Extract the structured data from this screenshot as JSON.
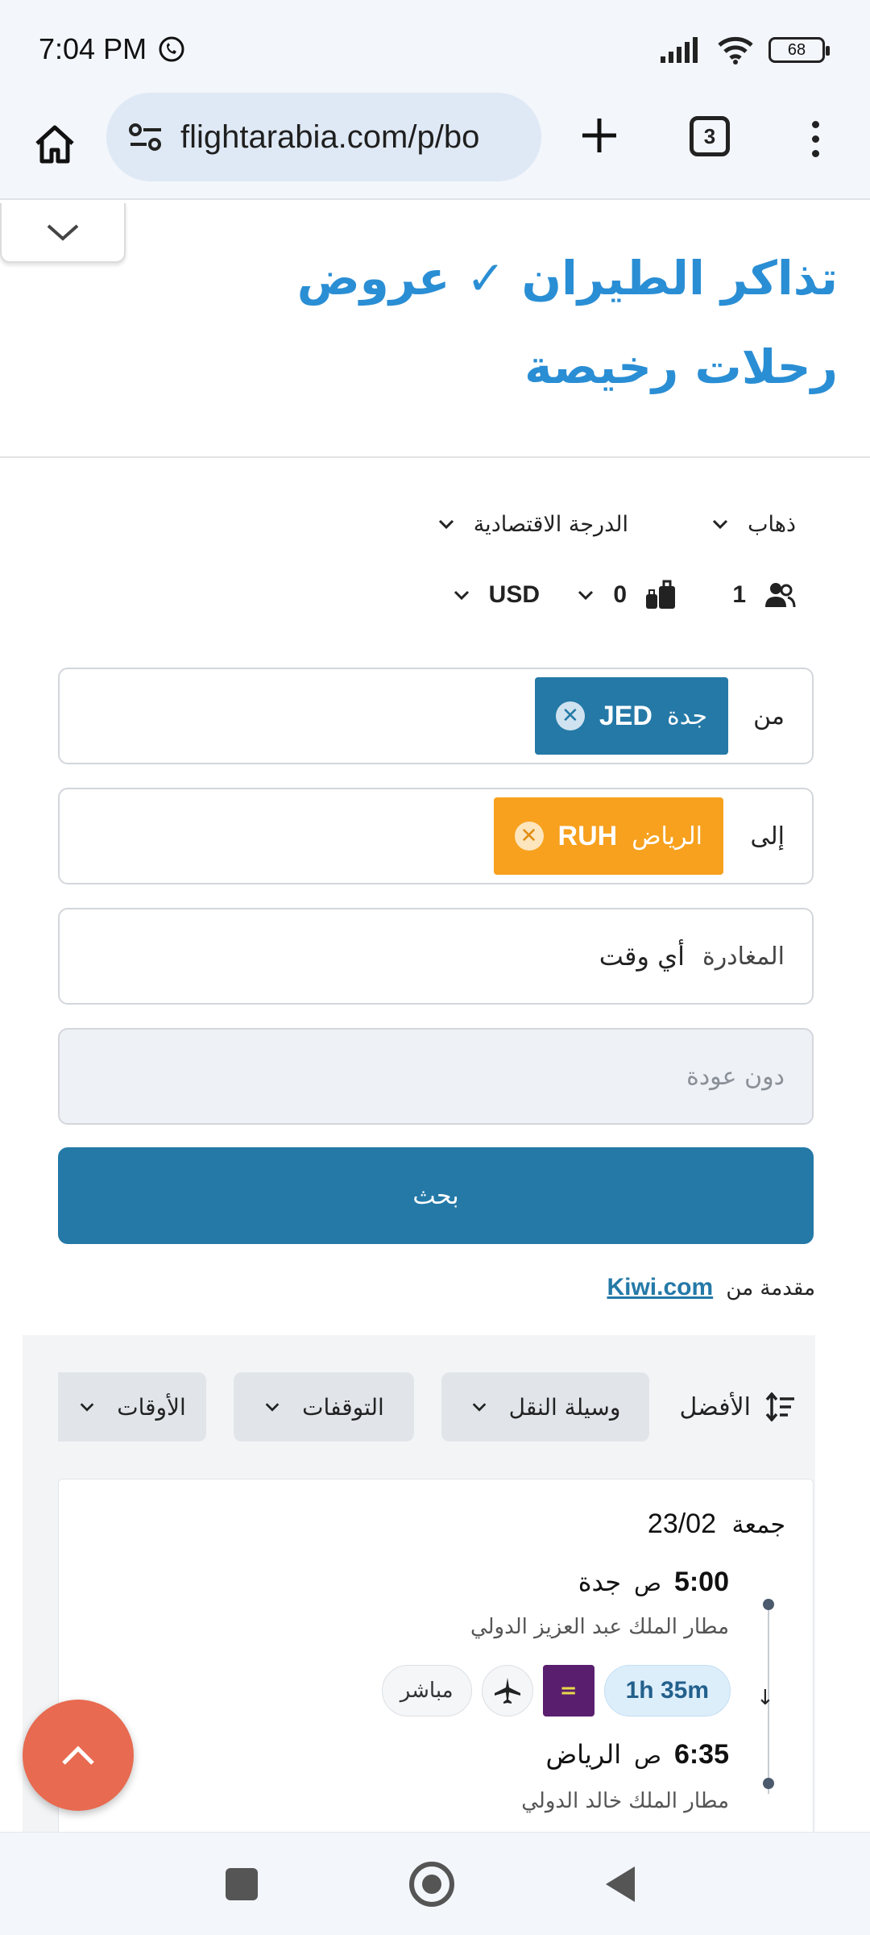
{
  "status": {
    "time": "7:04 PM",
    "battery": "68"
  },
  "browser": {
    "url": "flightarabia.com/p/bo",
    "tab_count": "3"
  },
  "page": {
    "title": "تذاكر الطيران ✓ عروض رحلات رخيصة"
  },
  "options": {
    "trip_type": "ذهاب",
    "cabin_class": "الدرجة الاقتصادية",
    "passengers": "1",
    "bags": "0",
    "currency": "USD"
  },
  "search": {
    "from_label": "من",
    "from_city": "جدة",
    "from_code": "JED",
    "to_label": "إلى",
    "to_city": "الرياض",
    "to_code": "RUH",
    "depart_label": "المغادرة",
    "depart_value": "أي وقت",
    "return_placeholder": "دون عودة",
    "search_button": "بحث",
    "powered_by_prefix": "مقدمة من",
    "powered_by_link": "Kiwi.com"
  },
  "filters": {
    "sort": "الأفضل",
    "transport": "وسيلة النقل",
    "stops": "التوقفات",
    "times": "الأوقات"
  },
  "result": {
    "day": "جمعة",
    "date": "23/02",
    "dep_time": "5:00",
    "dep_ampm": "ص",
    "dep_city": "جدة",
    "dep_airport": "مطار الملك عبد العزيز الدولي",
    "duration": "1h 35m",
    "airline_logo": "=",
    "direct": "مباشر",
    "arr_time": "6:35",
    "arr_ampm": "ص",
    "arr_city": "الرياض",
    "arr_airport": "مطار الملك خالد الدولي"
  },
  "icons": {
    "call": "call-icon",
    "signal": "signal-icon",
    "wifi": "wifi-icon",
    "home": "home-icon",
    "site_settings": "tune-icon",
    "new_tab": "plus-icon",
    "more": "more-vert-icon",
    "passengers": "people-icon",
    "bags": "luggage-icon",
    "sort": "sort-icon",
    "plane": "plane-icon",
    "scroll_top": "chevron-up-icon"
  },
  "colors": {
    "primary": "#2479a7",
    "title": "#2a8ed4",
    "destination_chip": "#f7a11e",
    "fab": "#e86a50"
  }
}
